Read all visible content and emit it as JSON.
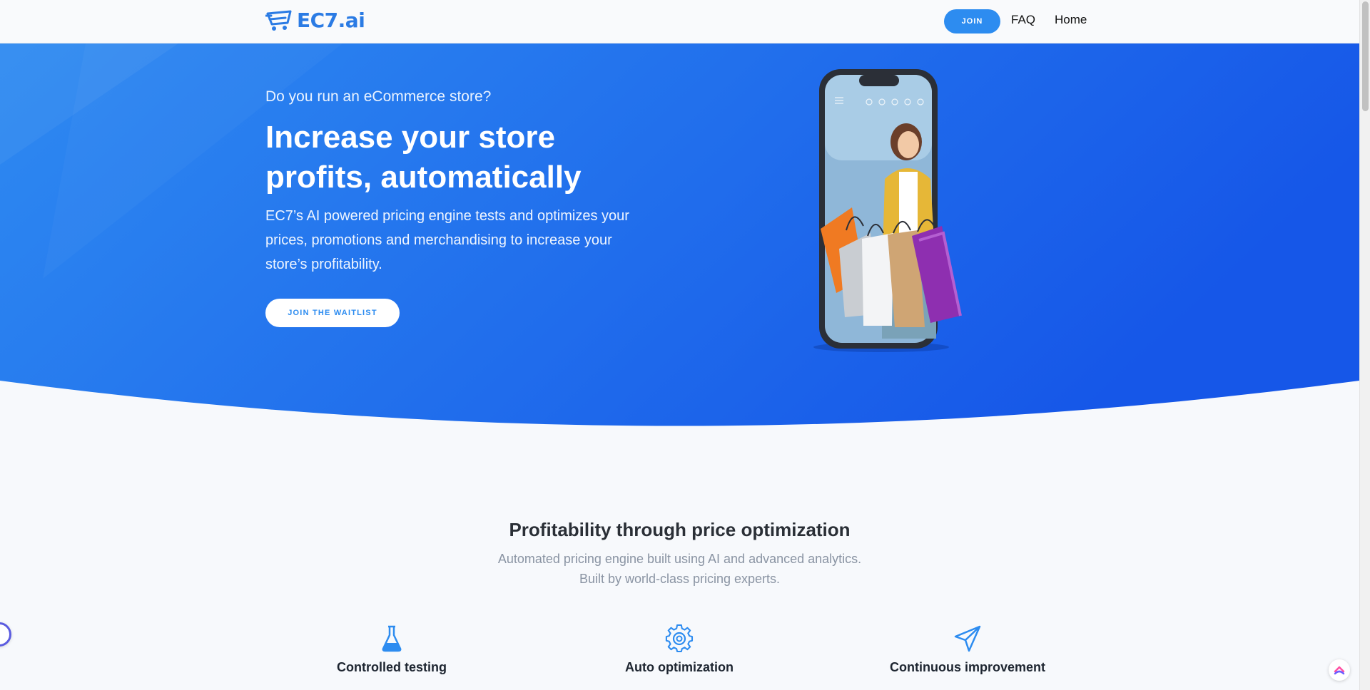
{
  "brand": {
    "name": "EC7.ai",
    "icon": "cart-logo-icon",
    "color": "#2b7be4"
  },
  "nav": {
    "join_label": "JOIN",
    "faq_label": "FAQ",
    "home_label": "Home"
  },
  "hero": {
    "eyebrow": "Do you run an eCommerce store?",
    "title": "Increase your store profits, automatically",
    "description": "EC7’s AI powered pricing engine tests and optimizes your prices, promotions and merchandising to increase your store’s profitability.",
    "cta_label": "JOIN THE WAITLIST",
    "image": "phone-shopper-with-bags",
    "colors": {
      "start": "#2e8af1",
      "end": "#1657e8"
    }
  },
  "features_section": {
    "title": "Profitability through price optimization",
    "subtitle_line1": "Automated pricing engine built using AI and advanced analytics.",
    "subtitle_line2": "Built by world-class pricing experts.",
    "items": [
      {
        "title": "Controlled testing",
        "icon": "flask-icon"
      },
      {
        "title": "Auto optimization",
        "icon": "gear-icon"
      },
      {
        "title": "Continuous improvement",
        "icon": "paper-plane-icon"
      }
    ]
  }
}
